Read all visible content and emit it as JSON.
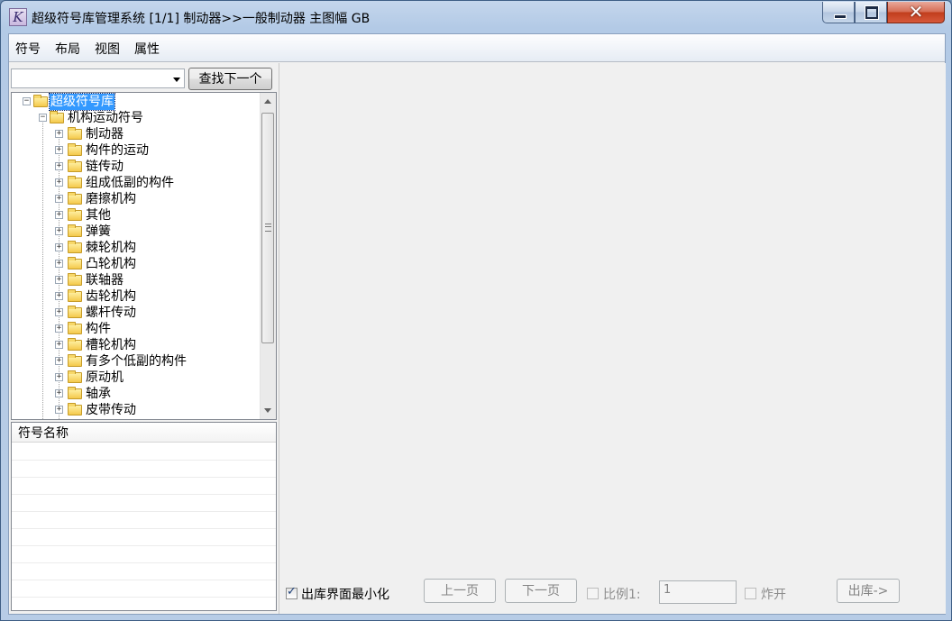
{
  "window": {
    "title": "超级符号库管理系统 [1/1] 制动器>>一般制动器 主图幅 GB",
    "icon_glyph": "K"
  },
  "menu": [
    "符号",
    "布局",
    "视图",
    "属性"
  ],
  "search": {
    "value": "",
    "find_next_label": "查找下一个"
  },
  "tree": {
    "root": "超级符号库",
    "category": "机构运动符号",
    "children": [
      "制动器",
      "构件的运动",
      "链传动",
      "组成低副的构件",
      "磨擦机构",
      "其他",
      "弹簧",
      "棘轮机构",
      "凸轮机构",
      "联轴器",
      "齿轮机构",
      "螺杆传动",
      "构件",
      "槽轮机构",
      "有多个低副的构件",
      "原动机",
      "轴承",
      "皮带传动"
    ]
  },
  "symbol_list": {
    "header": "符号名称"
  },
  "bottom": {
    "minimize_label": "出库界面最小化",
    "prev_page": "上一页",
    "next_page": "下一页",
    "ratio_label": "比例1:",
    "ratio_value": "1",
    "explode_label": "炸开",
    "export_label": "出库->"
  }
}
